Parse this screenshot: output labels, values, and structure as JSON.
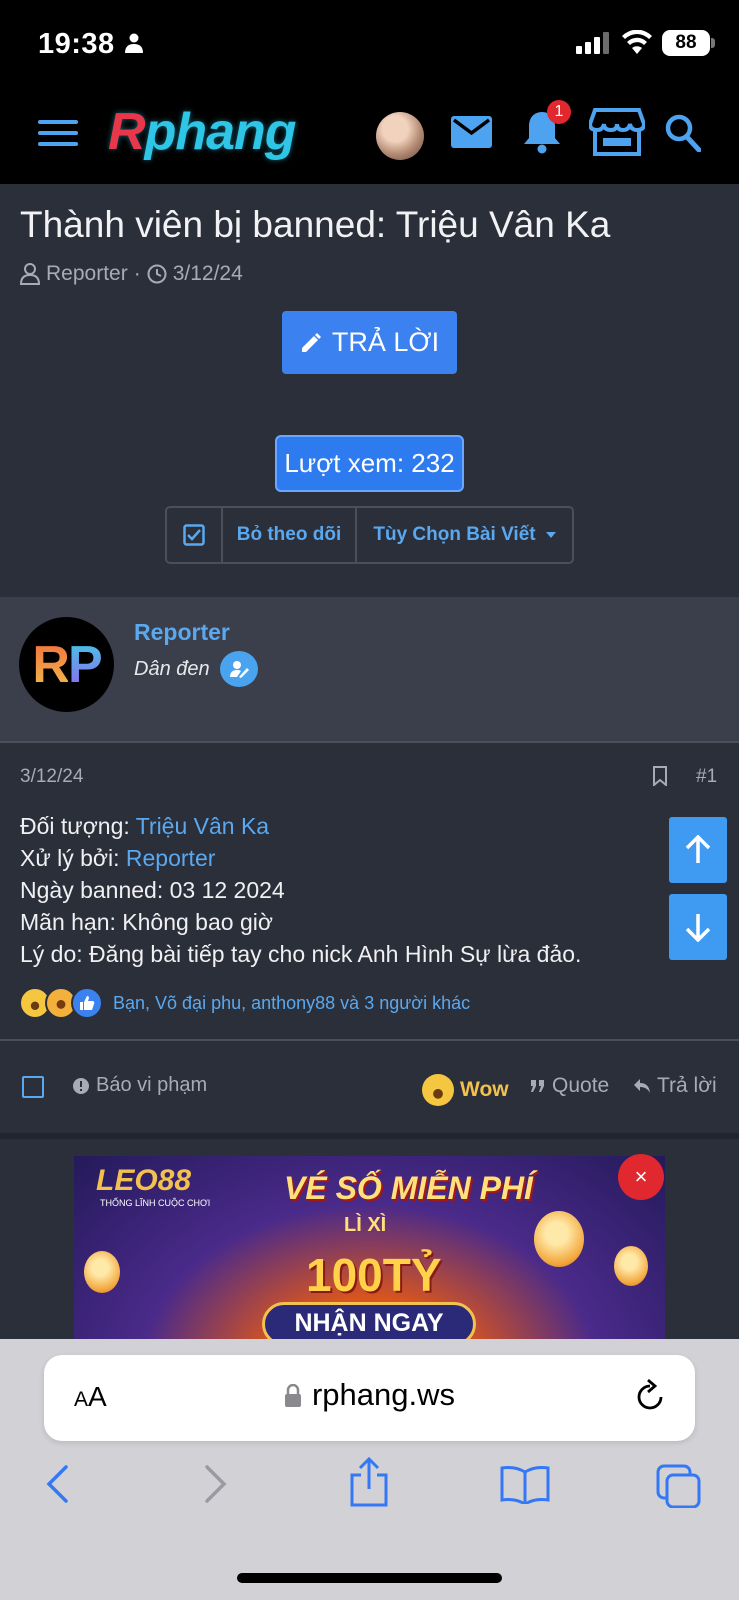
{
  "status_bar": {
    "time": "19:38",
    "battery": "88"
  },
  "header": {
    "logo": {
      "first": "R",
      "rest": "phang"
    },
    "notification_count": "1",
    "icons": [
      "menu-icon",
      "avatar",
      "mail-icon",
      "bell-icon",
      "store-icon",
      "search-icon"
    ]
  },
  "thread": {
    "title": "Thành viên bị banned: Triệu Vân Ka",
    "author": "Reporter",
    "date": "3/12/24",
    "reply_button": "TRẢ LỜI",
    "views": "Lượt xem: 232",
    "unwatch": "Bỏ theo dõi",
    "post_options": "Tùy Chọn Bài Viết"
  },
  "user": {
    "avatar_text": {
      "r": "R",
      "p": "P"
    },
    "name": "Reporter",
    "role": "Dân đen"
  },
  "post": {
    "date": "3/12/24",
    "number": "#1",
    "lines": {
      "subject_label": "Đối tượng: ",
      "subject_value": "Triệu Vân Ka",
      "handled_label": "Xử lý bởi: ",
      "handled_value": "Reporter",
      "banned_date": "Ngày banned: 03 12 2024",
      "expiry": "Mãn hạn: Không bao giờ",
      "reason": "Lý do: Đăng bài tiếp tay cho nick Anh Hình Sự lừa đảo."
    },
    "reactions_text": "Bạn, Võ đại phu, anthony88 và 3 người khác",
    "actions": {
      "report": "Báo vi phạm",
      "wow": "Wow",
      "quote": "Quote",
      "reply": "Trả lời"
    }
  },
  "ad": {
    "brand": "LEO88",
    "brand_sub": "THỐNG LĨNH CUỘC CHƠI",
    "title": "VÉ SỐ MIỄN PHÍ",
    "subtitle": "LÌ XÌ",
    "big": "100TỶ",
    "cta": "NHẬN NGAY",
    "close": "×"
  },
  "browser": {
    "aa_small": "A",
    "aa_big": "A",
    "url": "rphang.ws"
  },
  "colors": {
    "accent": "#3b82f0",
    "link": "#5aa8ef",
    "background": "#2b2f3a",
    "header_bg": "#000000",
    "badge": "#e0282e"
  }
}
